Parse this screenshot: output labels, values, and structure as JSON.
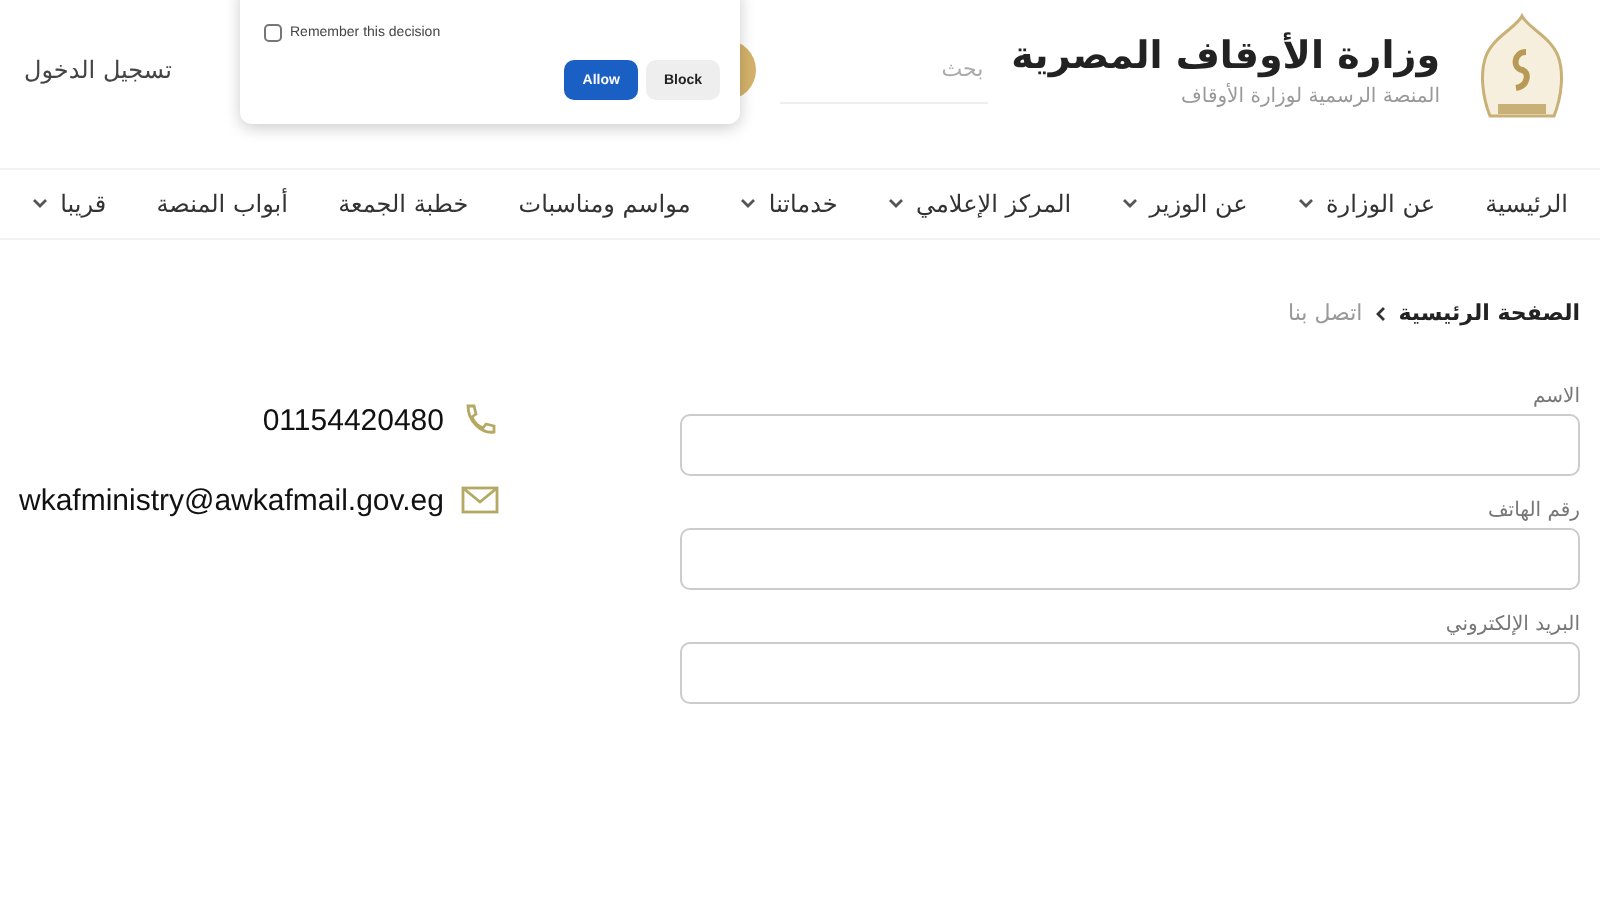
{
  "header": {
    "title": "وزارة الأوقاف المصرية",
    "subtitle": "المنصة الرسمية لوزارة الأوقاف",
    "search": {
      "placeholder": "بحث"
    },
    "login": "تسجيل الدخول"
  },
  "permission_popup": {
    "remember": {
      "label": "Remember this decision",
      "checked": false
    },
    "buttons": [
      {
        "label": "Block",
        "kind": "secondary"
      },
      {
        "label": "Allow",
        "kind": "primary"
      }
    ]
  },
  "nav": [
    {
      "label": "الرئيسية",
      "dropdown": false
    },
    {
      "label": "عن الوزارة",
      "dropdown": true
    },
    {
      "label": "عن الوزير",
      "dropdown": true
    },
    {
      "label": "المركز الإعلامي",
      "dropdown": true
    },
    {
      "label": "خدماتنا",
      "dropdown": true
    },
    {
      "label": "مواسم ومناسبات",
      "dropdown": false
    },
    {
      "label": "خطبة الجمعة",
      "dropdown": false
    },
    {
      "label": "أبواب المنصة",
      "dropdown": false
    },
    {
      "label": "قريبا",
      "dropdown": true
    }
  ],
  "breadcrumb": [
    {
      "label": "الصفحة الرئيسية",
      "current": false
    },
    {
      "label": "اتصل بنا",
      "current": true
    }
  ],
  "form": {
    "fields": [
      {
        "label": "الاسم"
      },
      {
        "label": "رقم الهاتف"
      },
      {
        "label": "البريد الإلكتروني"
      }
    ]
  },
  "contact": [
    {
      "kind": "phone",
      "text": "01154420480"
    },
    {
      "kind": "email",
      "text": "wkafministry@awkafmail.gov.eg"
    }
  ]
}
